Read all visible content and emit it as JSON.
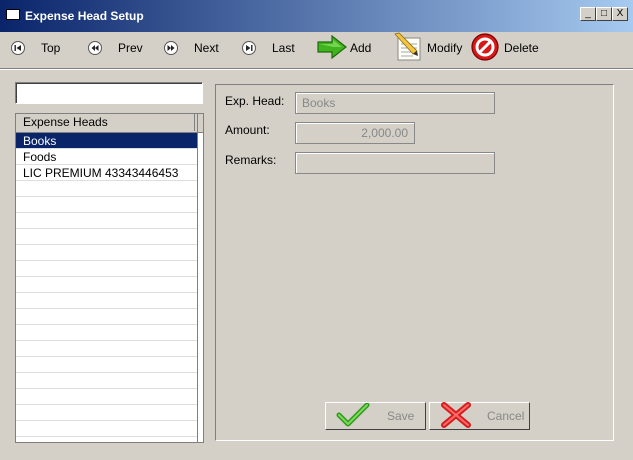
{
  "window": {
    "title": "Expense Head Setup",
    "controls": [
      "_",
      "□",
      "X"
    ]
  },
  "toolbar": {
    "top": "Top",
    "prev": "Prev",
    "next": "Next",
    "last": "Last",
    "add": "Add",
    "modify": "Modify",
    "delete": "Delete"
  },
  "search": {
    "value": ""
  },
  "list": {
    "header": "Expense Heads",
    "items": [
      "Books",
      "Foods",
      "LIC PREMIUM 43343446453"
    ],
    "selected": "Books"
  },
  "form": {
    "exp_head_label": "Exp. Head:",
    "exp_head_value": "Books",
    "amount_label": "Amount:",
    "amount_value": "2,000.00",
    "remarks_label": "Remarks:",
    "remarks_value": ""
  },
  "buttons": {
    "save": "Save",
    "cancel": "Cancel"
  },
  "colors": {
    "titlebar_start": "#0a246a",
    "titlebar_end": "#a6caf0",
    "selection": "#0a246a",
    "face": "#d4d0c8"
  }
}
